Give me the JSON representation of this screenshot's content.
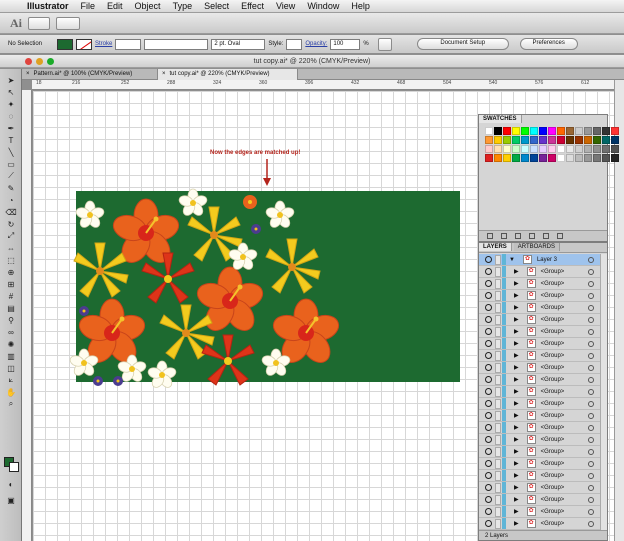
{
  "menubar": {
    "apple_icon": "apple-icon",
    "app_name": "Illustrator",
    "items": [
      "File",
      "Edit",
      "Object",
      "Type",
      "Select",
      "Effect",
      "View",
      "Window",
      "Help"
    ]
  },
  "appbar": {
    "logo": "Ai"
  },
  "control_bar": {
    "selection_label": "No Selection",
    "fill_color": "#1d6a30",
    "stroke_label": "Stroke",
    "brush_value": "2 pt. Oval",
    "style_label": "Style:",
    "opacity_label": "Opacity:",
    "opacity_value": "100",
    "opacity_unit": "%",
    "document_setup_label": "Document Setup",
    "preferences_label": "Preferences"
  },
  "window": {
    "title": "tut copy.ai* @ 220% (CMYK/Preview)",
    "tabs": [
      {
        "label": "Pattern.ai* @ 100% (CMYK/Preview)",
        "close": "×"
      },
      {
        "label": "tut copy.ai* @ 220% (CMYK/Preview)",
        "close": "×"
      }
    ]
  },
  "ruler": {
    "labels": [
      "18",
      "216",
      "252",
      "288",
      "324",
      "360",
      "396",
      "432",
      "468",
      "504",
      "540",
      "576",
      "612"
    ]
  },
  "canvas": {
    "note": "Now the edges are matched up!",
    "background_color": "#1d6a30"
  },
  "swatches": {
    "title": "SWATCHES",
    "colors": [
      "#ffffff",
      "#000000",
      "#ff0000",
      "#ffff00",
      "#00ff00",
      "#00ffff",
      "#0000ff",
      "#ff00ff",
      "#ff6600",
      "#996633",
      "#cccccc",
      "#999999",
      "#666666",
      "#333333",
      "#ff3333",
      "#ff9933",
      "#ffcc00",
      "#99cc00",
      "#00cc66",
      "#0099cc",
      "#3366cc",
      "#6633cc",
      "#cc3399",
      "#cc0033",
      "#663300",
      "#993300",
      "#cc6600",
      "#336600",
      "#006666",
      "#003366",
      "#ffcccc",
      "#ffe0b3",
      "#ffffcc",
      "#ccffcc",
      "#ccffff",
      "#cce0ff",
      "#e6ccff",
      "#ffccee",
      "#ffffff",
      "#e8e8e8",
      "#d0d0d0",
      "#b0b0b0",
      "#909090",
      "#707070",
      "#505050",
      "#e02020",
      "#ff8800",
      "#ffd000",
      "#00aa44",
      "#0088cc",
      "#004499",
      "#772299",
      "#cc0066",
      "#ffffff",
      "#dddddd",
      "#bbbbbb",
      "#999999",
      "#777777",
      "#555555",
      "#222222"
    ]
  },
  "layers": {
    "tab_layers": "LAYERS",
    "tab_artboards": "ARTBOARDS",
    "top_layer": "Layer 3",
    "group_label": "<Group>",
    "group_count": 23,
    "footer": "2 Layers"
  }
}
